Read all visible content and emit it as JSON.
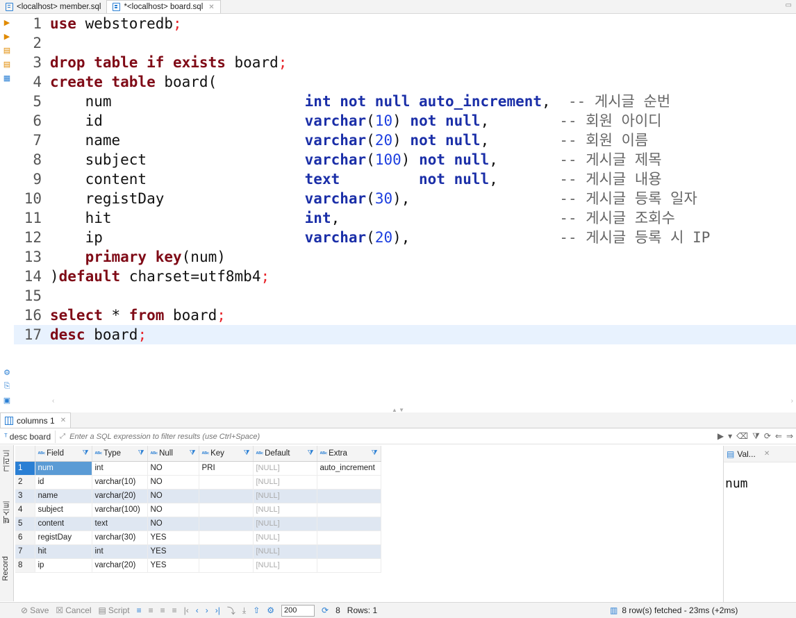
{
  "editor_tabs": [
    {
      "label": "<localhost> member.sql",
      "active": false
    },
    {
      "label": "*<localhost> board.sql",
      "active": true
    }
  ],
  "editor": {
    "current_line": 17,
    "lines": [
      {
        "n": "1",
        "segments": [
          [
            "kw",
            "use"
          ],
          [
            "p",
            " webstoredb"
          ],
          [
            "semi",
            ";"
          ]
        ]
      },
      {
        "n": "2",
        "segments": []
      },
      {
        "n": "3",
        "segments": [
          [
            "kw",
            "drop table if exists"
          ],
          [
            "p",
            " board"
          ],
          [
            "semi",
            ";"
          ]
        ]
      },
      {
        "n": "4",
        "segments": [
          [
            "kw",
            "create table"
          ],
          [
            "p",
            " board("
          ]
        ]
      },
      {
        "n": "5",
        "segments": [
          [
            "p",
            "    num                      "
          ],
          [
            "ty",
            "int not null auto_increment"
          ],
          [
            "p",
            ",  "
          ],
          [
            "cmt",
            "-- 게시글 순번"
          ]
        ]
      },
      {
        "n": "6",
        "segments": [
          [
            "p",
            "    id                       "
          ],
          [
            "ty",
            "varchar"
          ],
          [
            "p",
            "("
          ],
          [
            "nm",
            "10"
          ],
          [
            "p",
            ") "
          ],
          [
            "ty",
            "not null"
          ],
          [
            "p",
            ",        "
          ],
          [
            "cmt",
            "-- 회원 아이디"
          ]
        ]
      },
      {
        "n": "7",
        "segments": [
          [
            "p",
            "    name                     "
          ],
          [
            "ty",
            "varchar"
          ],
          [
            "p",
            "("
          ],
          [
            "nm",
            "20"
          ],
          [
            "p",
            ") "
          ],
          [
            "ty",
            "not null"
          ],
          [
            "p",
            ",        "
          ],
          [
            "cmt",
            "-- 회원 이름"
          ]
        ]
      },
      {
        "n": "8",
        "segments": [
          [
            "p",
            "    subject                  "
          ],
          [
            "ty",
            "varchar"
          ],
          [
            "p",
            "("
          ],
          [
            "nm",
            "100"
          ],
          [
            "p",
            ") "
          ],
          [
            "ty",
            "not null"
          ],
          [
            "p",
            ",       "
          ],
          [
            "cmt",
            "-- 게시글 제목"
          ]
        ]
      },
      {
        "n": "9",
        "segments": [
          [
            "p",
            "    content                  "
          ],
          [
            "ty",
            "text"
          ],
          [
            "p",
            "         "
          ],
          [
            "ty",
            "not null"
          ],
          [
            "p",
            ",       "
          ],
          [
            "cmt",
            "-- 게시글 내용"
          ]
        ]
      },
      {
        "n": "10",
        "segments": [
          [
            "p",
            "    registDay                "
          ],
          [
            "ty",
            "varchar"
          ],
          [
            "p",
            "("
          ],
          [
            "nm",
            "30"
          ],
          [
            "p",
            "),                 "
          ],
          [
            "cmt",
            "-- 게시글 등록 일자"
          ]
        ]
      },
      {
        "n": "11",
        "segments": [
          [
            "p",
            "    hit                      "
          ],
          [
            "ty",
            "int"
          ],
          [
            "p",
            ",                         "
          ],
          [
            "cmt",
            "-- 게시글 조회수"
          ]
        ]
      },
      {
        "n": "12",
        "segments": [
          [
            "p",
            "    ip                       "
          ],
          [
            "ty",
            "varchar"
          ],
          [
            "p",
            "("
          ],
          [
            "nm",
            "20"
          ],
          [
            "p",
            "),                 "
          ],
          [
            "cmt",
            "-- 게시글 등록 시 IP"
          ]
        ]
      },
      {
        "n": "13",
        "segments": [
          [
            "p",
            "    "
          ],
          [
            "kw",
            "primary key"
          ],
          [
            "p",
            "(num)"
          ]
        ]
      },
      {
        "n": "14",
        "segments": [
          [
            "p",
            ")"
          ],
          [
            "kw",
            "default"
          ],
          [
            "p",
            " charset=utf8mb4"
          ],
          [
            "semi",
            ";"
          ]
        ]
      },
      {
        "n": "15",
        "segments": []
      },
      {
        "n": "16",
        "segments": [
          [
            "kw",
            "select"
          ],
          [
            "p",
            " * "
          ],
          [
            "kw",
            "from"
          ],
          [
            "p",
            " board"
          ],
          [
            "semi",
            ";"
          ]
        ]
      },
      {
        "n": "17",
        "segments": [
          [
            "kw",
            "desc"
          ],
          [
            "p",
            " board"
          ],
          [
            "semi",
            ";"
          ]
        ]
      }
    ]
  },
  "results": {
    "tab_label": "columns 1",
    "query_name": "desc board",
    "filter_placeholder": "Enter a SQL expression to filter results (use Ctrl+Space)",
    "side_tabs": [
      "그리드",
      "텍스트",
      "Record"
    ],
    "columns": [
      "Field",
      "Type",
      "Null",
      "Key",
      "Default",
      "Extra"
    ],
    "rows": [
      {
        "n": "1",
        "cells": [
          "num",
          "int",
          "NO",
          "PRI",
          "[NULL]",
          "auto_increment"
        ]
      },
      {
        "n": "2",
        "cells": [
          "id",
          "varchar(10)",
          "NO",
          "",
          "[NULL]",
          ""
        ]
      },
      {
        "n": "3",
        "cells": [
          "name",
          "varchar(20)",
          "NO",
          "",
          "[NULL]",
          ""
        ]
      },
      {
        "n": "4",
        "cells": [
          "subject",
          "varchar(100)",
          "NO",
          "",
          "[NULL]",
          ""
        ]
      },
      {
        "n": "5",
        "cells": [
          "content",
          "text",
          "NO",
          "",
          "[NULL]",
          ""
        ]
      },
      {
        "n": "6",
        "cells": [
          "registDay",
          "varchar(30)",
          "YES",
          "",
          "[NULL]",
          ""
        ]
      },
      {
        "n": "7",
        "cells": [
          "hit",
          "int",
          "YES",
          "",
          "[NULL]",
          ""
        ]
      },
      {
        "n": "8",
        "cells": [
          "ip",
          "varchar(20)",
          "YES",
          "",
          "[NULL]",
          ""
        ]
      }
    ],
    "value_panel": {
      "title": "Val...",
      "value": "num"
    }
  },
  "status": {
    "save": "Save",
    "cancel": "Cancel",
    "script": "Script",
    "fetch_size": "200",
    "refresh_count": "8",
    "rows": "Rows: 1",
    "fetched": "8 row(s) fetched - 23ms (+2ms)"
  },
  "colors": {
    "accent": "#2a7fd4",
    "keyword": "#7f0a16",
    "type": "#1b2fa8",
    "current_line": "#e8f2fe"
  }
}
